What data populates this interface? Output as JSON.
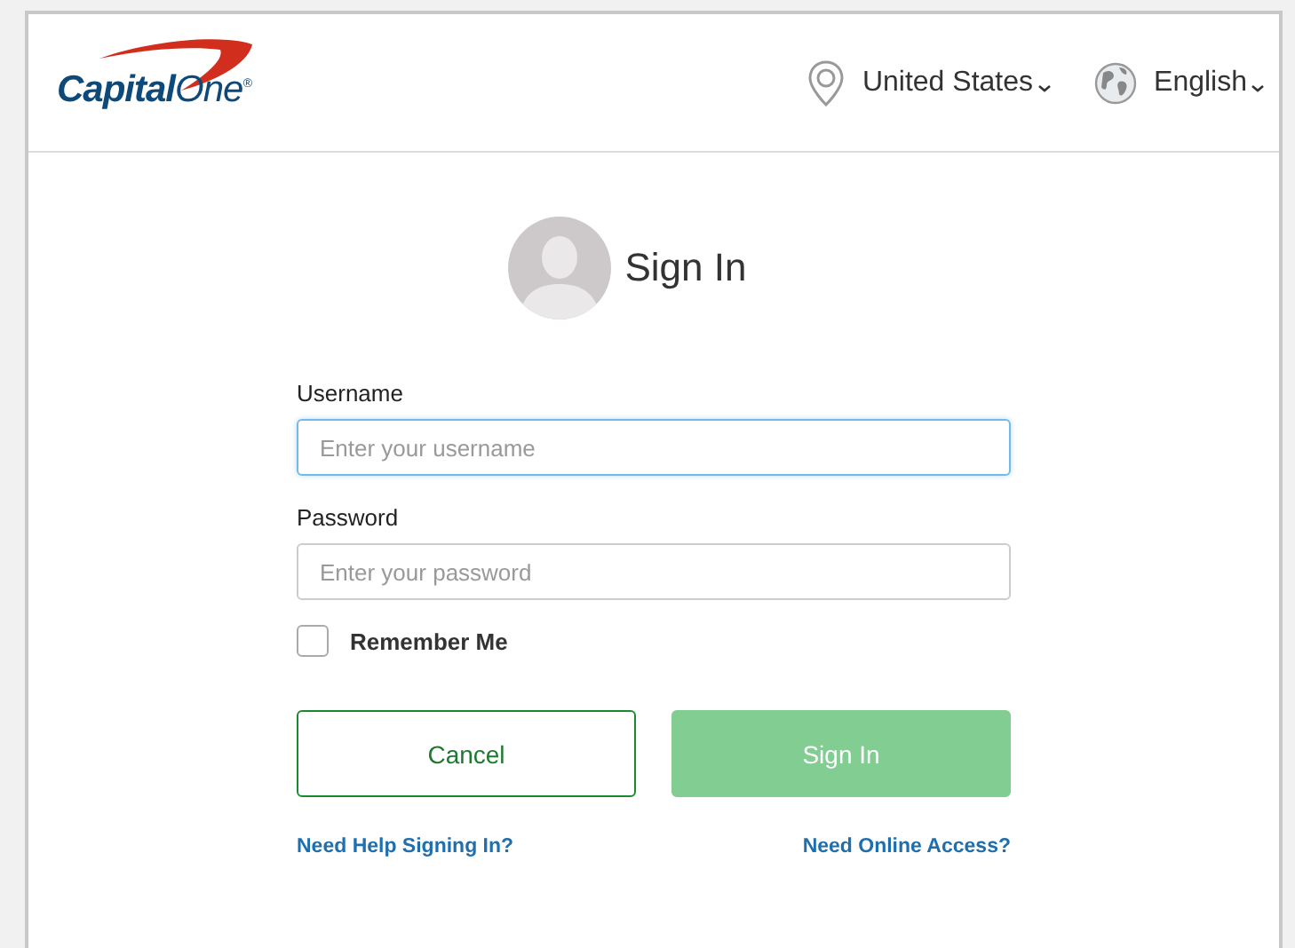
{
  "header": {
    "logo": "**Capital**One$^{®}$",
    "country": "United States",
    "language": "English"
  },
  "title": "Sign In",
  "fields": [
    {
      "label": "Username",
      "placeholder": "Enter your username",
      "focused": true
    },
    {
      "label": "Password",
      "placeholder": "Enter your password",
      "focused": false
    }
  ],
  "remember": {
    "label": "Remember Me",
    "checked": false
  },
  "buttons": [
    {
      "kind": "secondary",
      "label": "Cancel",
      "disabled": false
    },
    {
      "kind": "primary",
      "label": "Sign In",
      "disabled": true
    }
  ],
  "links": [
    "Need Help Signing In?",
    "Need Online Access?"
  ]
}
